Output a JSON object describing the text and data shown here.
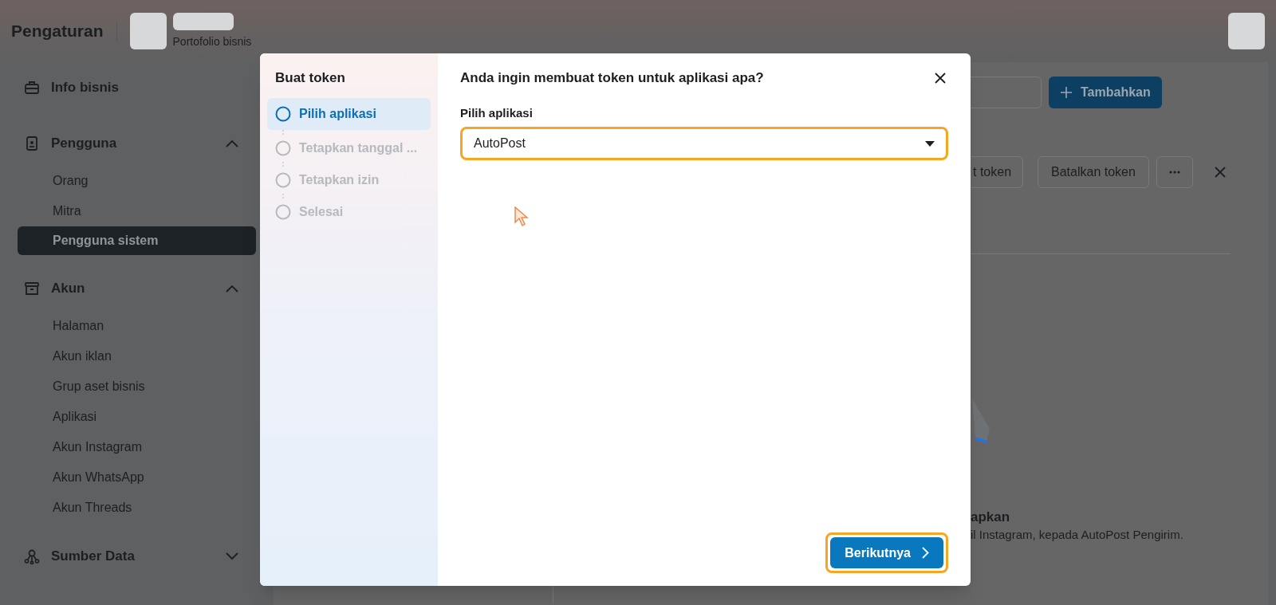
{
  "header": {
    "title": "Pengaturan",
    "portfolio_label": "Portofolio bisnis"
  },
  "sidebar": {
    "sections": [
      {
        "kind": "link",
        "label": "Info bisnis"
      },
      {
        "kind": "group",
        "label": "Pengguna",
        "expanded": true,
        "items": [
          {
            "label": "Orang",
            "selected": false
          },
          {
            "label": "Mitra",
            "selected": false
          },
          {
            "label": "Pengguna sistem",
            "selected": true
          }
        ]
      },
      {
        "kind": "group",
        "label": "Akun",
        "expanded": true,
        "items": [
          {
            "label": "Halaman",
            "selected": false
          },
          {
            "label": "Akun iklan",
            "selected": false
          },
          {
            "label": "Grup aset bisnis",
            "selected": false
          },
          {
            "label": "Aplikasi",
            "selected": false
          },
          {
            "label": "Akun Instagram",
            "selected": false
          },
          {
            "label": "Akun WhatsApp",
            "selected": false
          },
          {
            "label": "Akun Threads",
            "selected": false
          }
        ]
      },
      {
        "kind": "group",
        "label": "Sumber Data",
        "expanded": false
      }
    ]
  },
  "content": {
    "add_button": "Tambahkan",
    "token_buttons": [
      "t token",
      "Batalkan token"
    ],
    "empty_title": "apkan",
    "empty_text": "il Instagram, kepada AutoPost Pengirim."
  },
  "dialog": {
    "sidebar_title": "Buat token",
    "steps": [
      {
        "label": "Pilih aplikasi",
        "selected": true
      },
      {
        "label": "Tetapkan tanggal ...",
        "selected": false
      },
      {
        "label": "Tetapkan izin",
        "selected": false
      },
      {
        "label": "Selesai",
        "selected": false
      }
    ],
    "heading": "Anda ingin membuat token untuk aplikasi apa?",
    "field_label": "Pilih aplikasi",
    "field_value": "AutoPost",
    "field_highlighted": true,
    "next_button": "Berikutnya",
    "next_highlighted": true
  }
}
